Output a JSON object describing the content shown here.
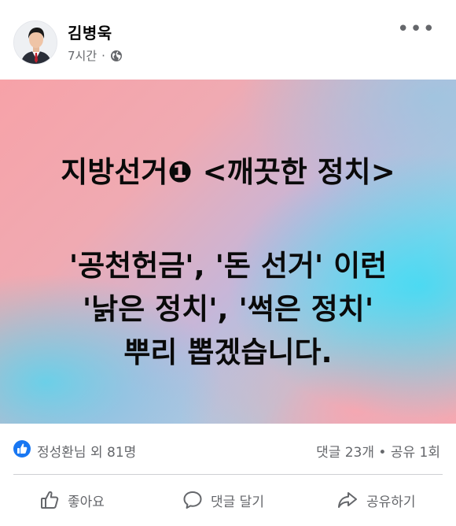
{
  "post": {
    "author": "김병욱",
    "time": "7시간",
    "separator": "·",
    "more_label": "•••",
    "lines": [
      "지방선거❶ <깨끗한 정치>",
      "'공천헌금', '돈 선거' 이런",
      "'낡은 정치', '썩은 정치'",
      "뿌리 뽑겠습니다."
    ]
  },
  "stats": {
    "reactors": "정성환님 외 81명",
    "counts": "댓글 23개 • 공유 1회"
  },
  "actions": {
    "like": "좋아요",
    "comment": "댓글 달기",
    "share": "공유하기"
  },
  "colors": {
    "like_blue": "#1877f2",
    "secondary_text": "#65676b"
  },
  "icons": {
    "privacy": "globe-icon",
    "reaction": "thumbs-up-icon",
    "comment": "speech-bubble-icon",
    "share": "share-arrow-icon",
    "more": "more-dots-icon"
  }
}
